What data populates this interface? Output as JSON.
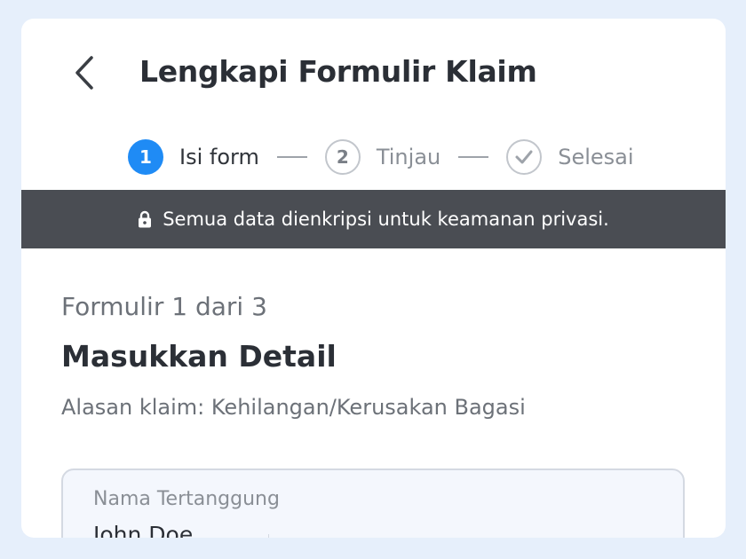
{
  "header": {
    "title": "Lengkapi Formulir Klaim"
  },
  "stepper": {
    "steps": [
      {
        "number": "1",
        "label": "Isi form",
        "state": "active"
      },
      {
        "number": "2",
        "label": "Tinjau",
        "state": "pending"
      },
      {
        "number": "",
        "label": "Selesai",
        "state": "pending",
        "icon": "check-icon"
      }
    ]
  },
  "banner": {
    "icon": "lock-icon",
    "text": "Semua data dienkripsi untuk keamanan privasi."
  },
  "form": {
    "counter": "Formulir 1 dari 3",
    "title": "Masukkan Detail",
    "reason": "Alasan klaim: Kehilangan/Kerusakan Bagasi",
    "fields": [
      {
        "label": "Nama Tertanggung",
        "value": "John Doe"
      }
    ]
  },
  "colors": {
    "accent": "#1f8bf5",
    "banner_bg": "#4a4d53",
    "page_bg": "#e6effb"
  }
}
